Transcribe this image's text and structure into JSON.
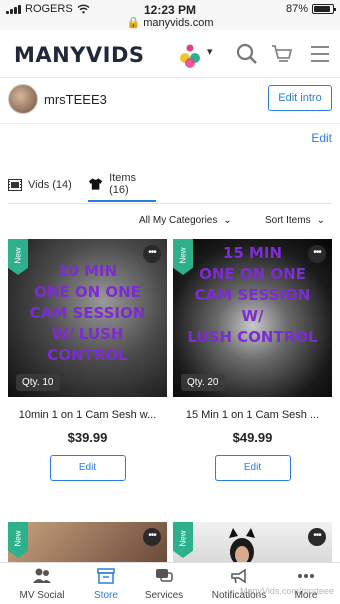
{
  "status_bar": {
    "carrier": "ROGERS",
    "time": "12:23 PM",
    "url": "manyvids.com",
    "battery": "87%",
    "battery_level": 0.87
  },
  "header": {
    "logo": "MANYVIDS",
    "icons": [
      "user-badge-icon",
      "chevron-down-icon",
      "search-icon",
      "cart-icon",
      "menu-icon"
    ]
  },
  "profile": {
    "username": "mrsTEEE3",
    "edit_intro": "Edit intro"
  },
  "edit_link": "Edit",
  "tabs": [
    {
      "label": "Vids (14)",
      "icon": "film-icon",
      "active": false
    },
    {
      "label": "Items (16)",
      "icon": "shirt-icon",
      "active": true
    }
  ],
  "filters": {
    "category": "All My Categories",
    "sort": "Sort Items"
  },
  "items": [
    {
      "tag": "New",
      "overlay": [
        "10 MIN",
        "ONE ON ONE",
        "CAM SESSION",
        "W/ LUSH CONTROL"
      ],
      "qty": "Qty. 10",
      "title": "10min 1 on 1 Cam Sesh w...",
      "price": "$39.99",
      "edit": "Edit"
    },
    {
      "tag": "New",
      "overlay": [
        "15 MIN",
        "ONE ON ONE",
        "CAM SESSION W/",
        "LUSH CONTROL"
      ],
      "qty": "Qty. 20",
      "title": "15 Min 1 on 1 Cam Sesh ...",
      "price": "$49.99",
      "edit": "Edit"
    },
    {
      "tag": "New"
    },
    {
      "tag": "New"
    }
  ],
  "bottom_nav": [
    {
      "label": "MV Social",
      "icon": "users-icon",
      "active": false
    },
    {
      "label": "Store",
      "icon": "store-icon",
      "active": true
    },
    {
      "label": "Services",
      "icon": "chat-icon",
      "active": false
    },
    {
      "label": "Notifications",
      "icon": "megaphone-icon",
      "active": false
    },
    {
      "label": "More",
      "icon": "more-icon",
      "active": false
    }
  ],
  "watermark": "ManyVids.com/mrsteee",
  "colors": {
    "accent": "#2a7de1",
    "new_tag": "#2fb08c",
    "overlay_text": "#7d2cd1"
  }
}
